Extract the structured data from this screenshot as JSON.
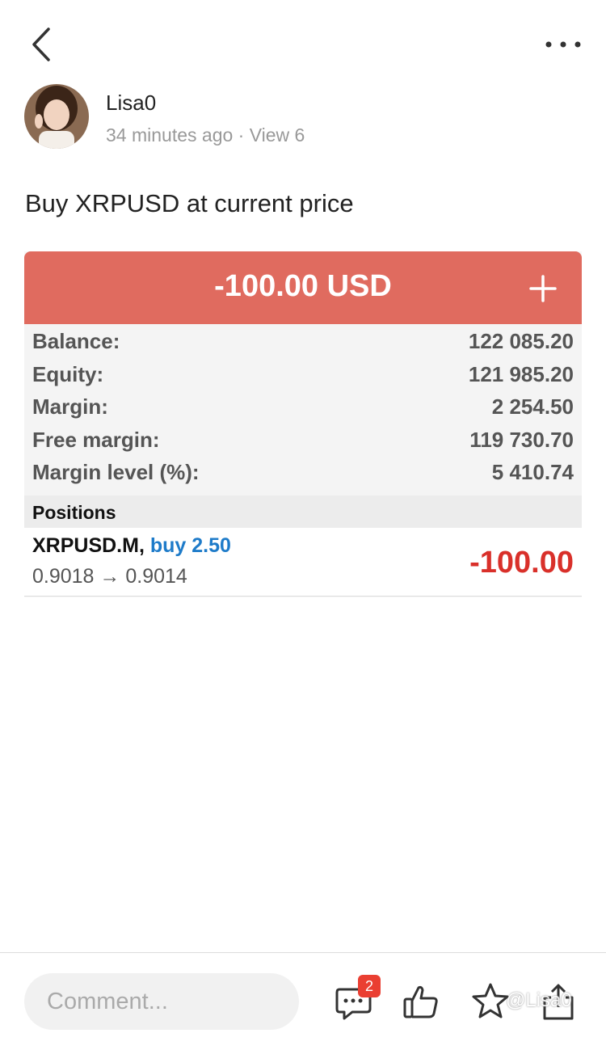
{
  "header": {
    "back_icon": "chevron-left-icon",
    "more_icon": "more-horizontal-icon"
  },
  "author": {
    "name": "Lisa0",
    "time": "34 minutes ago",
    "views": "View 6"
  },
  "post": {
    "text": "Buy XRPUSD at current price"
  },
  "trade_card": {
    "total_pnl": "-100.00 USD",
    "header_color": "#e06b5f",
    "summary": [
      {
        "label": "Balance:",
        "value": "122 085.20"
      },
      {
        "label": "Equity:",
        "value": "121 985.20"
      },
      {
        "label": "Margin:",
        "value": "2 254.50"
      },
      {
        "label": "Free margin:",
        "value": "119 730.70"
      },
      {
        "label": "Margin level (%):",
        "value": "5 410.74"
      }
    ],
    "positions_title": "Positions",
    "positions": [
      {
        "symbol": "XRPUSD.M,",
        "side": "buy 2.50",
        "prices": "0.9018 → 0.9014",
        "pnl": "-100.00"
      }
    ]
  },
  "footer": {
    "comment_placeholder": "Comment...",
    "comment_count": "2",
    "watermark": "@Lisa0"
  }
}
